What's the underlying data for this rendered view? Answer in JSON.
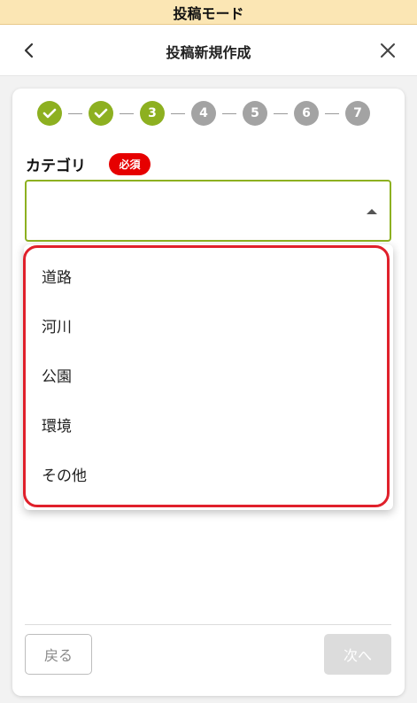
{
  "mode_bar": {
    "label": "投稿モード"
  },
  "nav": {
    "back_icon": "chevron-left-icon",
    "title": "投稿新規作成",
    "close_icon": "close-icon"
  },
  "steps": {
    "items": [
      {
        "label": "",
        "state": "done",
        "icon": "check-icon"
      },
      {
        "label": "",
        "state": "done",
        "icon": "check-icon"
      },
      {
        "label": "3",
        "state": "current"
      },
      {
        "label": "4",
        "state": "todo"
      },
      {
        "label": "5",
        "state": "todo"
      },
      {
        "label": "6",
        "state": "todo"
      },
      {
        "label": "7",
        "state": "todo"
      }
    ],
    "active_color": "#8db020",
    "inactive_color": "#a3a3a3"
  },
  "field": {
    "label": "カテゴリ",
    "required_badge": "必須",
    "selected_value": "",
    "arrow_icon": "caret-up-icon",
    "border_color": "#8db020"
  },
  "dropdown": {
    "options": [
      "道路",
      "河川",
      "公園",
      "環境",
      "その他"
    ],
    "highlight_color": "#e0202b"
  },
  "footer": {
    "back_label": "戻る",
    "next_label": "次へ"
  }
}
